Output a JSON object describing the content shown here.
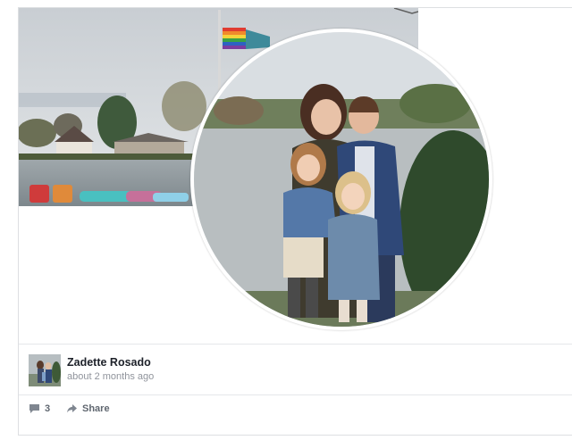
{
  "post": {
    "author": "Zadette Rosado",
    "timestamp": "about 2 months ago"
  },
  "actions": {
    "comment_count": "3",
    "share_label": "Share"
  },
  "colors": {
    "text_primary": "#1d2129",
    "text_secondary": "#90949c",
    "divider": "#e5e7ea",
    "action_text": "#606770"
  },
  "icons": [
    "comment-icon",
    "share-icon"
  ]
}
